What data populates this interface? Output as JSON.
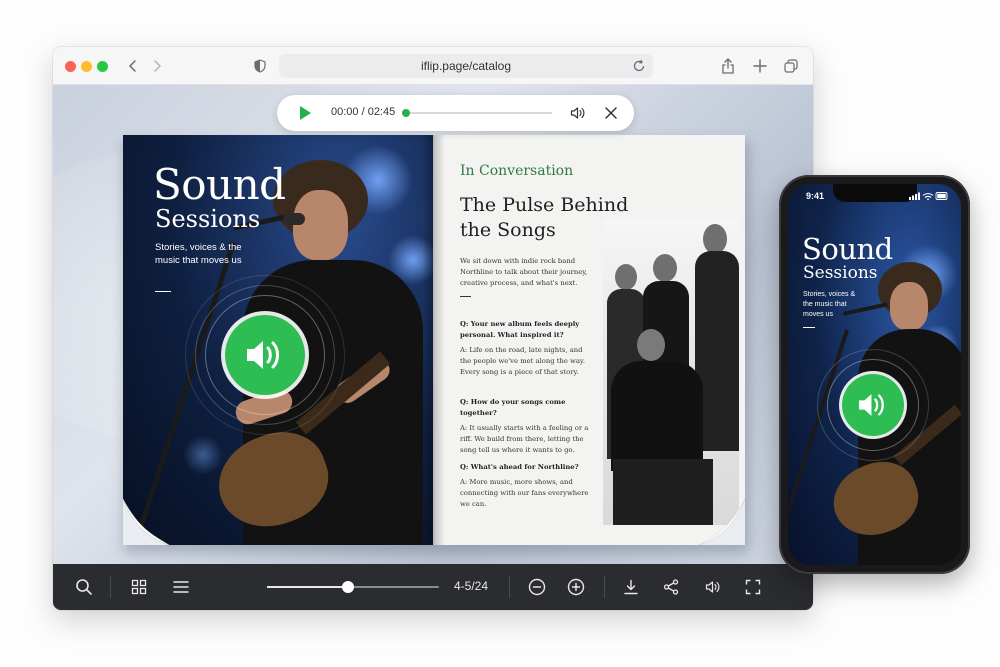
{
  "browser": {
    "url": "iflip.page/catalog"
  },
  "audio_player": {
    "time": "00:00 / 02:45",
    "progress": 0.0
  },
  "magazine": {
    "cover": {
      "title": "Sound",
      "subtitle": "Sessions",
      "description": "Stories, voices & the music that moves us"
    },
    "article": {
      "kicker": "In Conversation",
      "title": "The Pulse Behind the Songs",
      "intro": "We sit down with indie rock band Northline to talk about their journey, creative process, and what's next.",
      "qa": [
        {
          "q": "Q: Your new album feels deeply personal. What inspired it?",
          "a": "A: Life on the road, late nights, and the people we've met along the way. Every song is a piece of that story."
        },
        {
          "q": "Q: How do your songs come together?",
          "a": "A: It usually starts with a feeling or a riff. We build from there, letting the song tell us where it wants to go."
        },
        {
          "q": "Q: What's ahead for Northline?",
          "a": "A: More music, more shows, and connecting with our fans everywhere we can."
        }
      ]
    }
  },
  "toolbar": {
    "page_count": "4-5/24",
    "page_progress": 0.47,
    "icons": [
      "search-icon",
      "grid-icon",
      "menu-icon",
      "zoom-out-icon",
      "zoom-in-icon",
      "download-icon",
      "share-icon",
      "volume-icon",
      "fullscreen-icon"
    ]
  },
  "phone": {
    "time": "9:41",
    "title": "Sound",
    "subtitle": "Sessions",
    "description": "Stories, voices & the music that moves us"
  },
  "colors": {
    "accent_green": "#2ebd53",
    "toolbar_bg": "#2b2c30",
    "kicker_green": "#2f7a3e"
  }
}
